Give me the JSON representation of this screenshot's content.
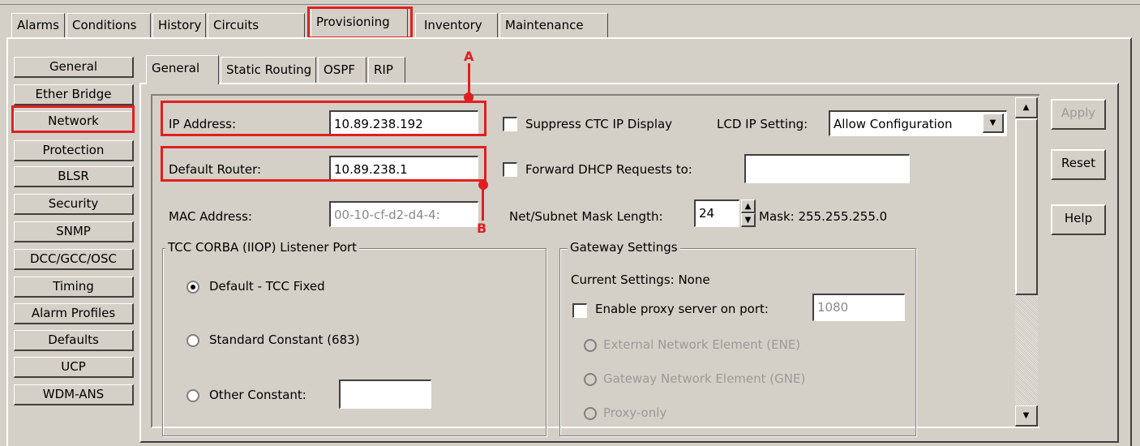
{
  "top_tabs": [
    "Alarms",
    "Conditions",
    "History",
    "Circuits",
    "Provisioning",
    "Inventory",
    "Maintenance"
  ],
  "side_items": [
    "General",
    "Ether Bridge",
    "Network",
    "Protection",
    "BLSR",
    "Security",
    "SNMP",
    "DCC/GCC/OSC",
    "Timing",
    "Alarm Profiles",
    "Defaults",
    "UCP",
    "WDM-ANS"
  ],
  "sub_tabs": [
    "General",
    "Static Routing",
    "OSPF",
    "RIP"
  ],
  "form": {
    "ip_label": "IP Address:",
    "ip_value": "10.89.238.192",
    "router_label": "Default Router:",
    "router_value": "10.89.238.1",
    "mac_label": "MAC Address:",
    "mac_value": "00-10-cf-d2-d4-4:",
    "suppress_label": "Suppress CTC IP Display",
    "lcd_label": "LCD IP Setting:",
    "lcd_value": "Allow Configuration",
    "dhcp_label": "Forward DHCP Requests to:",
    "dhcp_value": "",
    "mask_label": "Net/Subnet Mask Length:",
    "mask_value": "24",
    "mask_text": "Mask: 255.255.255.0"
  },
  "corba": {
    "title": "TCC CORBA (IIOP) Listener Port",
    "opt_default": "Default - TCC Fixed",
    "opt_standard": "Standard Constant (683)",
    "opt_other": "Other Constant:",
    "other_value": ""
  },
  "gateway": {
    "title": "Gateway Settings",
    "current": "Current Settings: None",
    "proxy_label": "Enable proxy server on port:",
    "proxy_port": "1080",
    "ene": "External Network Element (ENE)",
    "gne": "Gateway Network Element (GNE)",
    "proxy_only": "Proxy-only"
  },
  "buttons": {
    "apply": "Apply",
    "reset": "Reset",
    "help": "Help"
  },
  "annotations": {
    "a": "A",
    "b": "B"
  },
  "colors": {
    "highlight": "#e02020",
    "background": "#d4d0c8"
  }
}
